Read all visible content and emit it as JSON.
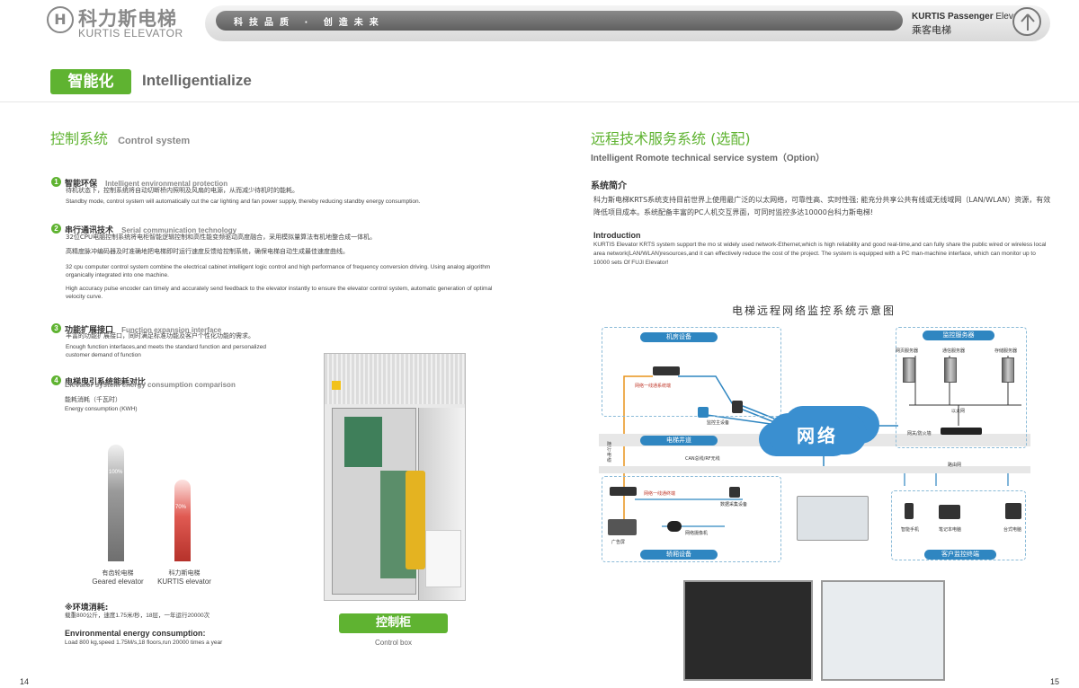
{
  "header": {
    "logo_mark": "H",
    "logo_cn": "科力斯电梯",
    "logo_en": "KURTIS ELEVATOR",
    "slogan": "科技品质 · 创造未来",
    "passenger_en_brand": "KURTIS Passenger",
    "passenger_en_suffix": "Elevator",
    "passenger_cn": "乘客电梯"
  },
  "section": {
    "tag_cn": "智能化",
    "tag_en": "Intelligentialize"
  },
  "left": {
    "title_cn": "控制系统",
    "title_en": "Control system",
    "items": [
      {
        "num": "1",
        "cn": "智能环保",
        "en": "Intelligent environmental protection",
        "text_cn": "待机状态下，控制系统将自动切断桥内照明及风扇的电源，从而减少待机时的能耗。",
        "text_en": "Standby mode, control system will automatically cut the car lighting and fan power supply, thereby reducing standby energy consumption."
      },
      {
        "num": "2",
        "cn": "串行通讯技术",
        "en": "Serial communication technology",
        "text_cn": "32位CPU电脑控制系统将电柜智能逻辑控制和高性能变频驱动高度融合，采用模拟量算法有机地整合成一体机。",
        "text_cn2": "高精度脉冲编码器及时准确地把电梯即时运行速度反馈给控制系统，确保电梯自动生成最佳速度曲线。",
        "text_en": "32 cpu computer control system combine the electrical cabinet intelligent logic control and high performance of frequency conversion driving. Using analog algorithm organically integrated into one machine.",
        "text_en2": "High accuracy pulse encoder can timely and accurately send feedback to the elevator instantly to ensure the elevator control system, automatic generation of optimal velocity curve."
      },
      {
        "num": "3",
        "cn": "功能扩展接口",
        "en": "Function expansion interface",
        "text_cn": "丰富的功能扩展接口，同时满足标准功能及客户个性化功能的需求。",
        "text_en": "Enough function interfaces,and meets the standard function and personalized customer demand of function"
      },
      {
        "num": "4",
        "cn": "电梯曳引系统能耗对比",
        "en": "Elevator system energy consumption comparison"
      }
    ],
    "chart_label_cn": "能耗消耗（千瓦时）",
    "chart_label_en": "Energy consumption (KWH)",
    "chart_data": {
      "type": "bar",
      "categories": [
        "有齿轮电梯 Geared elevator",
        "科力斯电梯 KURTIS elevator"
      ],
      "values": [
        100,
        70
      ],
      "value_labels": [
        "100%",
        "70%"
      ],
      "ylim": [
        0,
        100
      ],
      "colors": [
        "#9a9a9a",
        "#e05a52"
      ]
    },
    "bar1_cn": "有齿轮电梯",
    "bar1_en": "Geared elevator",
    "bar2_cn": "科力斯电梯",
    "bar2_en": "KURTIS elevator",
    "env_cn": "※环境消耗:",
    "env_cn_text": "载重800公斤，速度1.75米/秒，18层，一年运行20000次",
    "env_en": "Environmental energy consumption:",
    "env_en_text": "Load 800 kg,speed 1.75M/s,18 floors,run 20000 times a year",
    "cabinet_cn": "控制柜",
    "cabinet_en": "Control box",
    "page_num": "14"
  },
  "right": {
    "title_cn": "远程技术服务系统 (选配)",
    "title_en": "Intelligent Romote technical service system（Option）",
    "sub_cn": "系统简介",
    "text_cn": "科力斯电梯KRTS系统支持目前世界上使用最广泛的以太网络，可靠性高、实时性强; 能充分共享公共有线或无线域网（LAN/WLAN）资源，有效降低项目成本。系统配备丰富的PC人机交互界面，可同时监控多达10000台科力斯电梯!",
    "intro_h": "Introduction",
    "intro": "KURTIS Elevator KRTS system support the mo st widely used network-Ethernet,which is high reliability and good real-time,and can fully share the public wired or wireless local area network(LAN/WLAN)resources,and it can effectively reduce the cost of the project. The system is equipped with a PC man-machine interface, which can monitor up to 10000 sets Of FUJI Elevator!",
    "diagram_title": "电梯远程网络监控系统示意图",
    "diagram": {
      "machine_room": "机房设备",
      "monitor_server": "监控服务器",
      "shaft": "电梯井道",
      "car": "轿厢设备",
      "client": "客户监控终端",
      "cloud": "网络",
      "lbl_net_converter": "网络一线通系统端",
      "lbl_monitor_master": "监控主设备",
      "lbl_web_server": "网页服务器",
      "lbl_comm_server": "通信服务器",
      "lbl_storage_server": "存储服务器",
      "lbl_ethernet": "以太网",
      "lbl_gateway": "网关/防火墙",
      "lbl_router": "路由网",
      "lbl_can_bus": "CAN总线/RF无线",
      "lbl_shaft_cable": "随行电缆",
      "lbl_net_car": "网络一线通终端",
      "lbl_data_collect": "数据采集设备",
      "lbl_ad_screen": "广告屏",
      "lbl_camera": "网络摄像机",
      "lbl_phone": "智能手机",
      "lbl_laptop": "笔记本电脑",
      "lbl_desktop": "台式电脑"
    },
    "page_num": "15"
  }
}
